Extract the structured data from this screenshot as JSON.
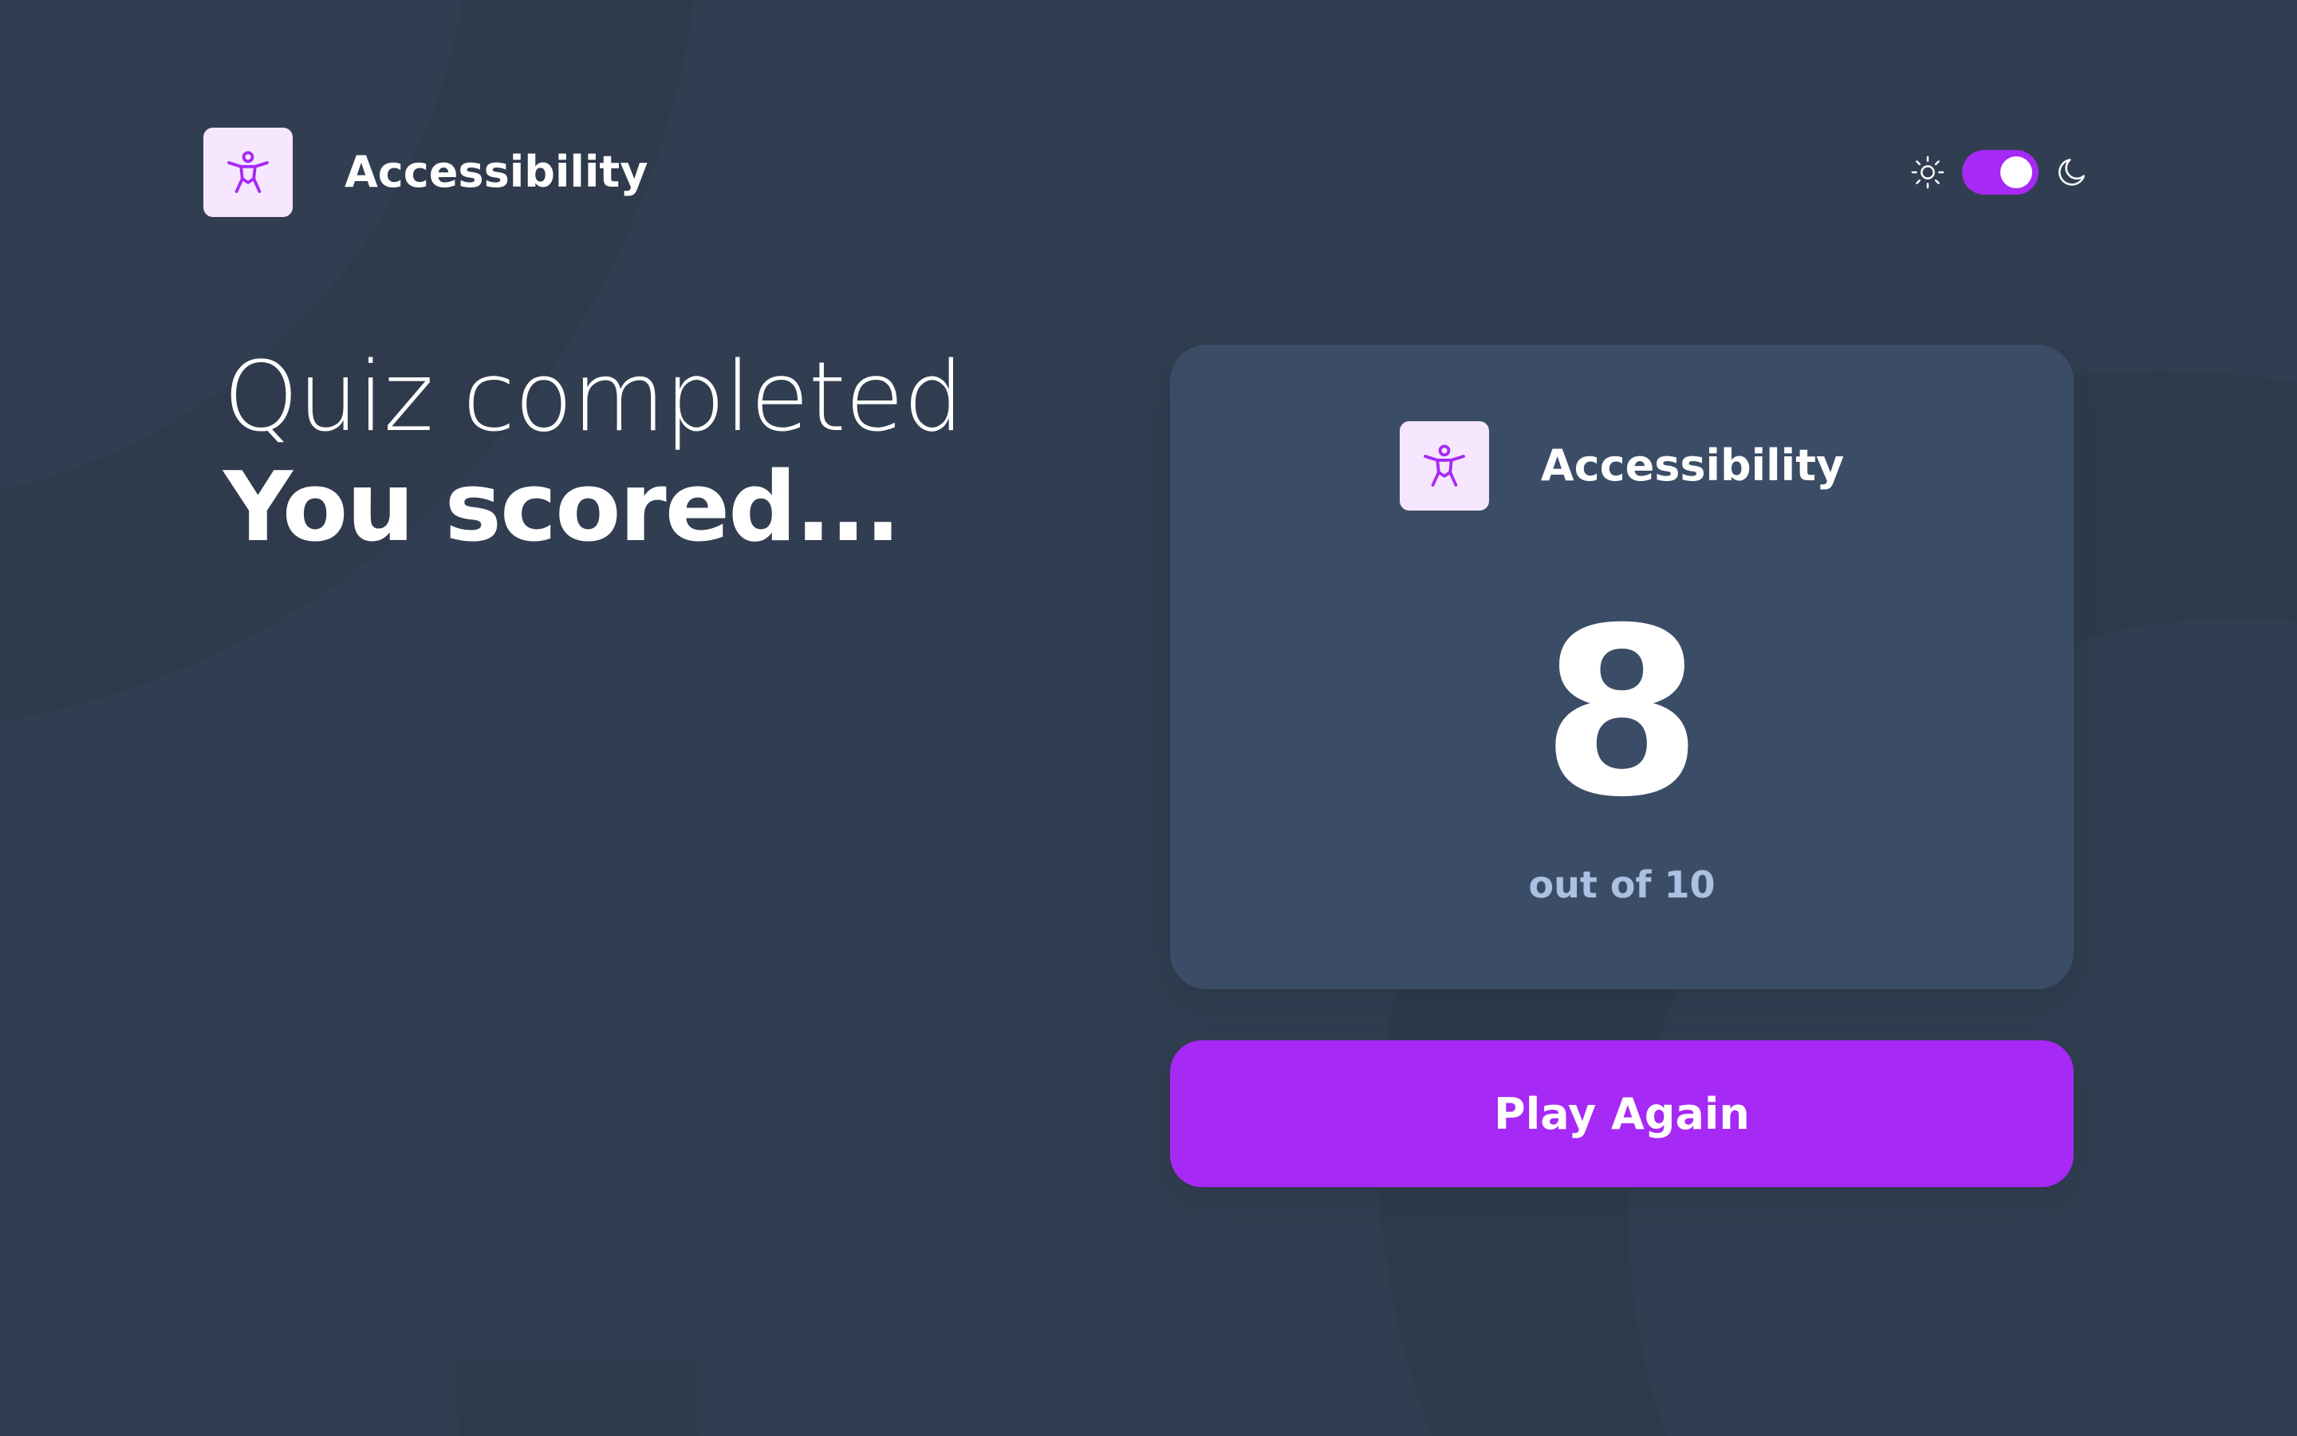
{
  "header": {
    "subject_title": "Accessibility",
    "subject_icon": "accessibility-icon",
    "theme_toggle": {
      "light_icon": "sun-icon",
      "dark_icon": "moon-icon",
      "dark_mode_on": true
    }
  },
  "heading": {
    "line1": "Quiz completed",
    "line2": "You scored..."
  },
  "score_card": {
    "subject_title": "Accessibility",
    "subject_icon": "accessibility-icon",
    "score": "8",
    "total_label": "out of 10"
  },
  "actions": {
    "play_again_label": "Play Again"
  },
  "colors": {
    "background": "#313e51",
    "card": "#3b4d66",
    "accent": "#a729f5",
    "icon_tile": "#f6e7ff",
    "muted_text": "#abc1e1"
  }
}
